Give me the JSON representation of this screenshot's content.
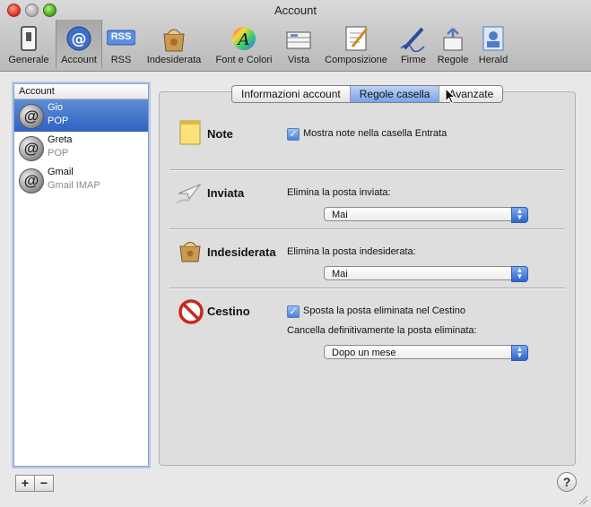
{
  "window": {
    "title": "Account"
  },
  "toolbar": {
    "items": [
      {
        "label": "Generale",
        "icon": "switch-icon"
      },
      {
        "label": "Account",
        "icon": "at-icon"
      },
      {
        "label": "RSS",
        "icon": "rss-icon"
      },
      {
        "label": "Indesiderata",
        "icon": "junk-icon"
      },
      {
        "label": "Font e Colori",
        "icon": "font-color-icon"
      },
      {
        "label": "Vista",
        "icon": "view-icon"
      },
      {
        "label": "Composizione",
        "icon": "compose-icon"
      },
      {
        "label": "Firme",
        "icon": "signature-icon"
      },
      {
        "label": "Regole",
        "icon": "rules-icon"
      },
      {
        "label": "Herald",
        "icon": "herald-icon"
      }
    ],
    "selected": "Account",
    "rss_badge": "RSS"
  },
  "sidebar": {
    "header": "Account",
    "accounts": [
      {
        "name": "Gio",
        "type": "POP"
      },
      {
        "name": "Greta",
        "type": "POP"
      },
      {
        "name": "Gmail",
        "type": "Gmail IMAP"
      }
    ],
    "add_label": "+",
    "remove_label": "−"
  },
  "tabs": [
    {
      "label": "Informazioni account"
    },
    {
      "label": "Regole casella"
    },
    {
      "label": "Avanzate"
    }
  ],
  "sections": {
    "note": {
      "title": "Note",
      "checkbox_label": "Mostra note nella casella Entrata",
      "checked": true
    },
    "inviata": {
      "title": "Inviata",
      "field_label": "Elimina la posta inviata:",
      "value": "Mai"
    },
    "indesiderata": {
      "title": "Indesiderata",
      "field_label": "Elimina la posta indesiderata:",
      "value": "Mai"
    },
    "cestino": {
      "title": "Cestino",
      "checkbox_label": "Sposta la posta eliminata nel Cestino",
      "checked": true,
      "field_label": "Cancella definitivamente la posta eliminata:",
      "value": "Dopo un mese"
    }
  },
  "help_label": "?",
  "colors": {
    "accent": "#2f62c1",
    "window_bg": "#e8e8e8"
  }
}
